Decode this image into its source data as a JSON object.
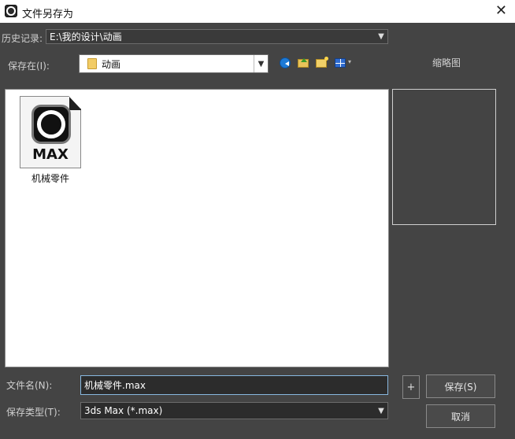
{
  "window": {
    "title": "文件另存为",
    "close_glyph": "✕"
  },
  "history": {
    "label": "历史记录:",
    "value": "E:\\我的设计\\动画"
  },
  "save_in": {
    "label": "保存在(I):",
    "value": "动画"
  },
  "toolbar": {
    "icons": [
      "back-icon",
      "up-folder-icon",
      "new-folder-icon",
      "view-menu-icon"
    ],
    "view_arrow": "▾"
  },
  "thumbnail": {
    "label": "缩略图"
  },
  "files": [
    {
      "name": "机械零件",
      "icon_label": "MAX"
    }
  ],
  "filename": {
    "label": "文件名(N):",
    "value": "机械零件.max"
  },
  "filetype": {
    "label": "保存类型(T):",
    "value": "3ds Max (*.max)"
  },
  "buttons": {
    "plus": "+",
    "save": "保存(S)",
    "cancel": "取消"
  },
  "colors": {
    "background": "#444444",
    "titlebar": "#ffffff",
    "list_bg": "#ffffff"
  }
}
